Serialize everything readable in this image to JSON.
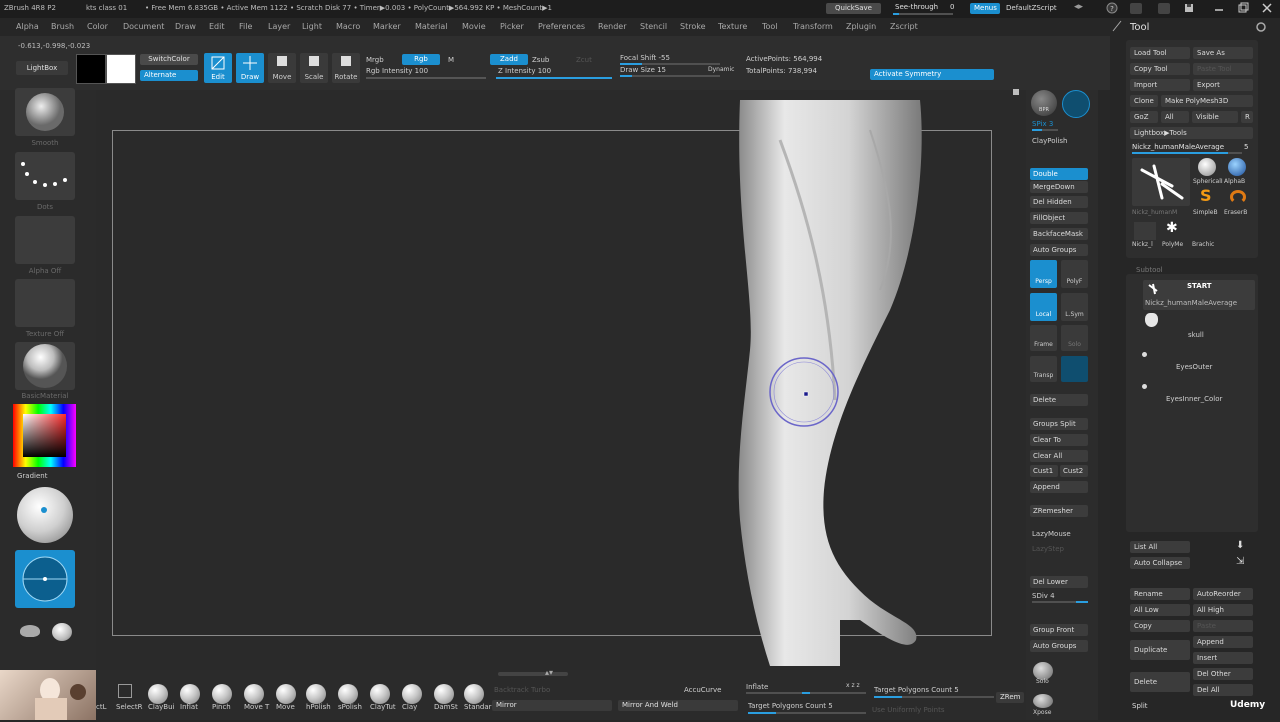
{
  "titlebar": {
    "app": "ZBrush 4R8 P2",
    "doc": "kts class 01",
    "stats": "• Free Mem 6.835GB • Active Mem 1122 • Scratch Disk 77 • Timer▶0.003 • PolyCount▶564.992 KP • MeshCount▶1",
    "quicksave": "QuickSave",
    "seethrough": "See-through",
    "seethrough_value": "0",
    "menus": "Menus",
    "zscript": "DefaultZScript"
  },
  "menubar": [
    "Alpha",
    "Brush",
    "Color",
    "Document",
    "Draw",
    "Edit",
    "File",
    "Layer",
    "Light",
    "Macro",
    "Marker",
    "Material",
    "Movie",
    "Picker",
    "Preferences",
    "Render",
    "Stencil",
    "Stroke",
    "Texture",
    "Tool",
    "Transform",
    "Zplugin",
    "Zscript"
  ],
  "coords": "-0.613,-0.998,-0.023",
  "toolbar": {
    "lightbox": "LightBox",
    "switchcolor": "SwitchColor",
    "alternate": "Alternate",
    "edit": "Edit",
    "draw": "Draw",
    "move": "Move",
    "scale": "Scale",
    "rotate": "Rotate",
    "mrgb": "Mrgb",
    "rgb": "Rgb",
    "m": "M",
    "rgb_intensity": "Rgb Intensity 100",
    "zadd": "Zadd",
    "zsub": "Zsub",
    "zcut": "Zcut",
    "z_intensity": "Z Intensity 100",
    "focal_shift": "Focal Shift -55",
    "draw_size": "Draw Size 15",
    "dynamic": "Dynamic",
    "active_points": "ActivePoints: 564,994",
    "total_points": "TotalPoints: 738,994",
    "activate_symmetry": "Activate Symmetry"
  },
  "leftshelf": {
    "brush_label": "Smooth",
    "stroke_label": "Dots",
    "alpha_label": "Alpha Off",
    "texture_label": "Texture Off",
    "material_label": "BasicMaterial",
    "gradient_label": "Gradient"
  },
  "rightshelf": {
    "bpr": "BPR",
    "spix": "SPix 3",
    "claypolish": "ClayPolish",
    "double": "Double",
    "mergedown": "MergeDown",
    "delhidden": "Del Hidden",
    "fillobject": "FillObject",
    "backfacemask": "BackfaceMask",
    "autogroups": "Auto Groups",
    "persp": "Persp",
    "polyf": "PolyF",
    "local": "Local",
    "lsym": "L.Sym",
    "frame": "Frame",
    "solo": "Solo",
    "transp": "Transp",
    "delete": "Delete",
    "groupssplit": "Groups Split",
    "clearto": "Clear To",
    "clearall": "Clear All",
    "cust1": "Cust1",
    "cust2": "Cust2",
    "append": "Append",
    "zremesher": "ZRemesher",
    "lazymouse": "LazyMouse",
    "lazystep": "LazyStep",
    "dellower": "Del Lower",
    "sdiv": "SDiv 4",
    "groupfront": "Group Front",
    "autogroups2": "Auto Groups",
    "solo2": "Solo",
    "xpose": "Xpose"
  },
  "toolpanel": {
    "title": "Tool",
    "load_tool": "Load Tool",
    "save_as": "Save As",
    "copy_tool": "Copy Tool",
    "paste_tool": "Paste Tool",
    "import": "Import",
    "export": "Export",
    "clone": "Clone",
    "make_polymesh": "Make PolyMesh3D",
    "goz": "GoZ",
    "all": "All",
    "visible": "Visible",
    "r": "R",
    "lightbox_tools": "Lightbox▶Tools",
    "current_tool": "Nickz_humanMaleAverage",
    "current_tool_value": "5",
    "tool_spherical": "SphericalI",
    "tool_alphabrush": "AlphaB",
    "tool_simple": "SimpleB",
    "tool_eraser": "EraserB",
    "tool_current_short": "Nickz_humanM",
    "tool_short2": "Nickz_l",
    "tool_polymesh": "PolyMe",
    "tool_brachial": "Brachic",
    "subtool": "Subtool",
    "subtool_start": "START",
    "subtool_1": "Nickz_humanMaleAverage",
    "subtool_2": "skull",
    "subtool_3": "EyesOuter",
    "subtool_4": "EyesInner_Color",
    "list_all": "List All",
    "auto_collapse": "Auto Collapse",
    "rename": "Rename",
    "autoreorder": "AutoReorder",
    "all_low": "All Low",
    "all_high": "All High",
    "copy": "Copy",
    "paste": "Paste",
    "duplicate": "Duplicate",
    "append": "Append",
    "insert": "Insert",
    "delete": "Delete",
    "del_other": "Del Other",
    "del_all": "Del All",
    "split": "Split"
  },
  "bottombar": {
    "brushes": [
      "ctL",
      "SelectR",
      "ClayBui",
      "Inflat",
      "Pinch",
      "Move T",
      "Move",
      "hPolish",
      "sPolish",
      "ClayTut",
      "Clay",
      "DamSt",
      "Standar"
    ],
    "backtrack": "Backtrack Turbo",
    "accucurve": "AccuCurve",
    "inflate": "Inflate",
    "mirror": "Mirror",
    "mirror_weld": "Mirror And Weld",
    "target_poly_1": "Target Polygons Count 5",
    "target_poly_2": "Target Polygons Count 5",
    "use_uv": "Use Uniformly Points",
    "zremesher": "ZRem",
    "watermark": "Udemy",
    "xyz": "x z z"
  },
  "colors": {
    "accent": "#1b8fcf",
    "panel": "#2b2b2b",
    "canvas": "#2a2a2a"
  }
}
